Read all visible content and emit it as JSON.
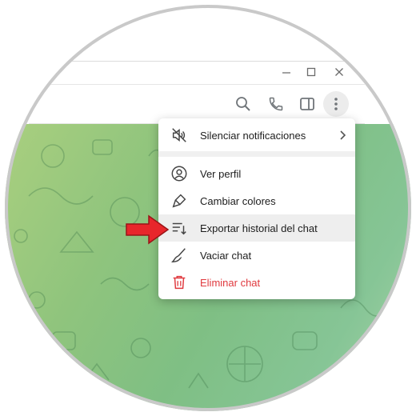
{
  "window": {
    "controls": [
      {
        "name": "minimize-icon"
      },
      {
        "name": "maximize-icon"
      },
      {
        "name": "close-icon"
      }
    ]
  },
  "header": {
    "actions": [
      "search-icon",
      "phone-icon",
      "sidebar-toggle-icon",
      "more-vertical-icon"
    ]
  },
  "menu": {
    "items": [
      {
        "label": "Silenciar notificaciones",
        "icon": "mute-icon",
        "has_submenu": true
      },
      {
        "label": "Ver perfil",
        "icon": "profile-icon"
      },
      {
        "label": "Cambiar colores",
        "icon": "paint-icon"
      },
      {
        "label": "Exportar historial del chat",
        "icon": "export-icon",
        "highlighted": true
      },
      {
        "label": "Vaciar chat",
        "icon": "broom-icon"
      },
      {
        "label": "Eliminar chat",
        "icon": "trash-icon",
        "danger": true
      }
    ]
  },
  "colors": {
    "danger": "#e0393e",
    "annotation_arrow": "#e8262b",
    "chat_background": "#86c58a"
  }
}
